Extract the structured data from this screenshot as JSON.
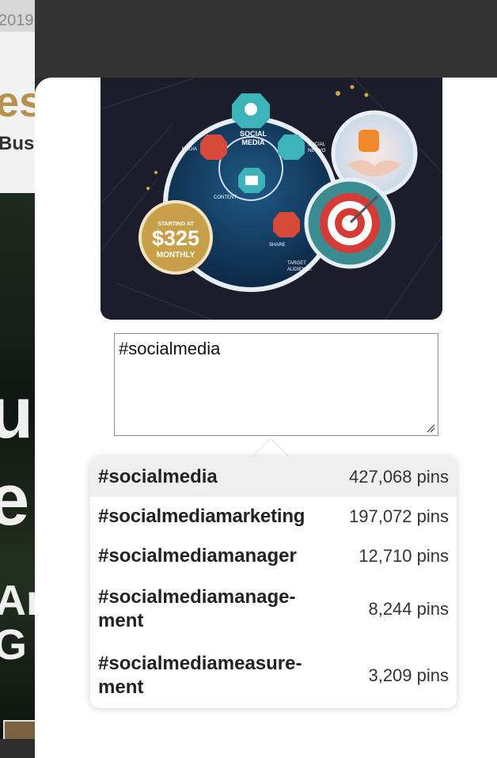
{
  "background": {
    "year_fragment": "2019.",
    "logo_fragment": "es",
    "logo_sub_fragment": "Bus",
    "headline_fragment_1": "u",
    "headline_fragment_2": "e",
    "headline_fragment_3": "An",
    "headline_fragment_4": "G"
  },
  "hero_image": {
    "labels": {
      "social_media": [
        "SOCIAL",
        "MEDIA"
      ],
      "media": "MEDIA",
      "content": "CONTENT",
      "share": "SHARE",
      "social_network": [
        "SOCIAL",
        "NETWO"
      ],
      "target_audience": [
        "TARGET",
        "AUDIENCE"
      ]
    },
    "badge": {
      "top": "STARTING AT",
      "price": "$325",
      "bottom": "MONTHLY"
    }
  },
  "input": {
    "value": "#socialmedia"
  },
  "suggestions": [
    {
      "tag_lines": [
        "#socialmedia"
      ],
      "count": "427,068 pins"
    },
    {
      "tag_lines": [
        "#socialmediamarketing"
      ],
      "count": "197,072 pins"
    },
    {
      "tag_lines": [
        "#socialmediamanager"
      ],
      "count": "12,710 pins"
    },
    {
      "tag_lines": [
        "#socialmediamanage-",
        "ment"
      ],
      "count": "8,244 pins"
    },
    {
      "tag_lines": [
        "#socialmediameasure-",
        "ment"
      ],
      "count": "3,209 pins"
    }
  ],
  "colors": {
    "teal": "#3bb3b8",
    "red": "#d74a3a",
    "gold": "#c8a04a",
    "navy": "#16385e"
  }
}
